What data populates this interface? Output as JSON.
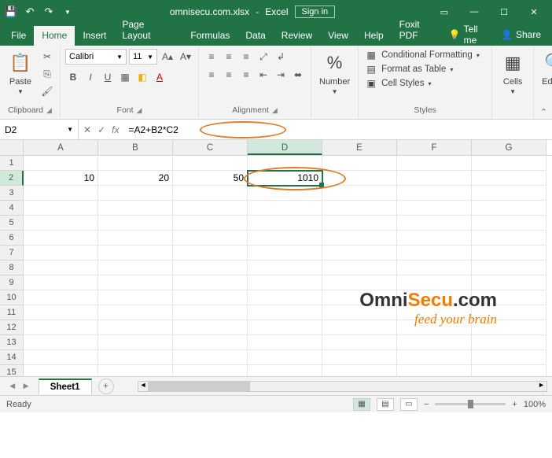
{
  "titlebar": {
    "filename": "omnisecu.com.xlsx",
    "app": "Excel",
    "signin": "Sign in"
  },
  "tabs": {
    "file": "File",
    "home": "Home",
    "insert": "Insert",
    "pageLayout": "Page Layout",
    "formulas": "Formulas",
    "data": "Data",
    "review": "Review",
    "view": "View",
    "help": "Help",
    "foxit": "Foxit PDF",
    "tellme": "Tell me",
    "share": "Share"
  },
  "ribbon": {
    "paste": "Paste",
    "clipboard": "Clipboard",
    "fontName": "Calibri",
    "fontSize": "11",
    "font": "Font",
    "alignment": "Alignment",
    "number": "Number",
    "condFmt": "Conditional Formatting",
    "fmtTable": "Format as Table",
    "cellStyles": "Cell Styles",
    "styles": "Styles",
    "cells": "Cells",
    "editing": "Editing"
  },
  "formulaBar": {
    "nameBox": "D2",
    "formula": "=A2+B2*C2"
  },
  "grid": {
    "columns": [
      "A",
      "B",
      "C",
      "D",
      "E",
      "F",
      "G"
    ],
    "rowCount": 15,
    "activeCol": "D",
    "activeRow": 2,
    "cells": {
      "A2": "10",
      "B2": "20",
      "C2": "50",
      "D2": "1010"
    }
  },
  "sheetTabs": {
    "active": "Sheet1"
  },
  "statusBar": {
    "status": "Ready",
    "zoom": "100%"
  },
  "watermark": {
    "brand1a": "Omni",
    "brand1b": "Secu",
    "brand1c": ".com",
    "tagline": "feed your brain"
  }
}
